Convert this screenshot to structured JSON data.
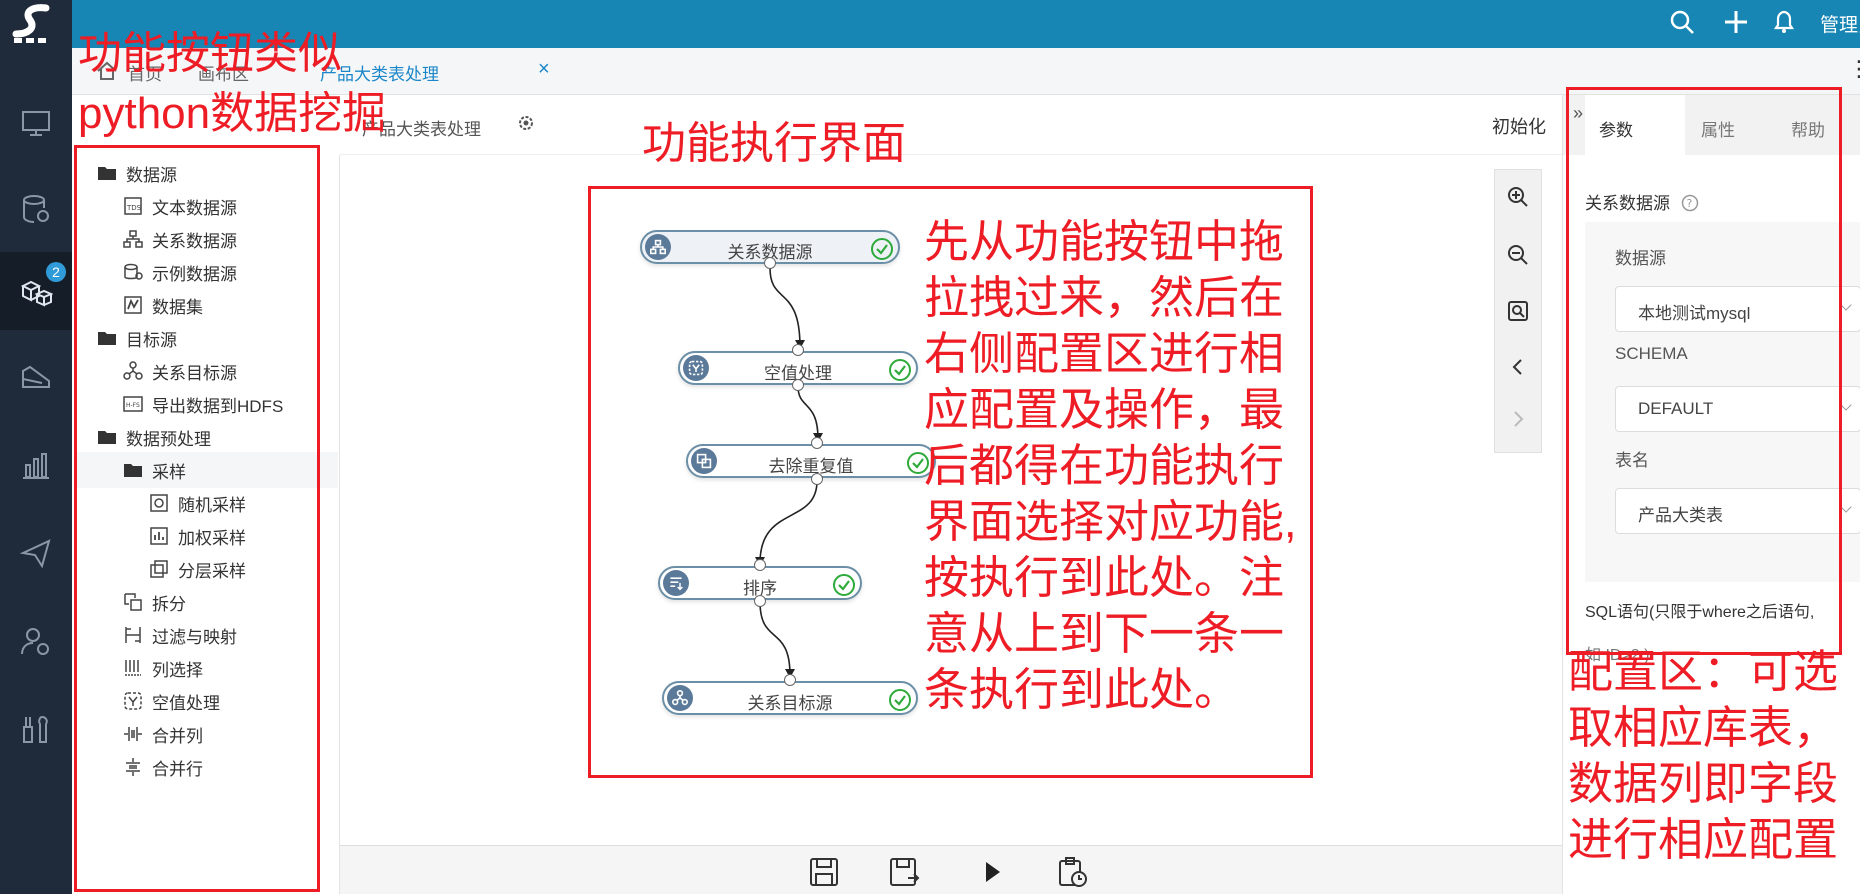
{
  "header": {
    "user_label": "管理员"
  },
  "nav_rail": {
    "badge_count": "2"
  },
  "tabs": [
    {
      "label": "首页"
    },
    {
      "label": "画布区"
    },
    {
      "label": "产品大类表处理"
    }
  ],
  "workspace": {
    "title": "产品大类表处理",
    "init_label": "初始化"
  },
  "tree": {
    "items": [
      {
        "label": "数据源",
        "icon": "folder-icon"
      },
      {
        "label": "文本数据源",
        "icon": "txt-file-icon"
      },
      {
        "label": "关系数据源",
        "icon": "relational-icon"
      },
      {
        "label": "示例数据源",
        "icon": "database-icon"
      },
      {
        "label": "数据集",
        "icon": "dataset-icon"
      },
      {
        "label": "目标源",
        "icon": "folder-icon"
      },
      {
        "label": "关系目标源",
        "icon": "relational-target-icon"
      },
      {
        "label": "导出数据到HDFS",
        "icon": "hdfs-icon"
      },
      {
        "label": "数据预处理",
        "icon": "folder-icon"
      },
      {
        "label": "采样",
        "icon": "folder-icon"
      },
      {
        "label": "随机采样",
        "icon": "random-sample-icon"
      },
      {
        "label": "加权采样",
        "icon": "weighted-sample-icon"
      },
      {
        "label": "分层采样",
        "icon": "layered-sample-icon"
      },
      {
        "label": "拆分",
        "icon": "split-icon"
      },
      {
        "label": "过滤与映射",
        "icon": "filter-icon"
      },
      {
        "label": "列选择",
        "icon": "column-select-icon"
      },
      {
        "label": "空值处理",
        "icon": "null-handle-icon"
      },
      {
        "label": "合并列",
        "icon": "merge-column-icon"
      },
      {
        "label": "合并行",
        "icon": "merge-row-icon"
      }
    ]
  },
  "flow": {
    "nodes": [
      {
        "label": "关系数据源",
        "status": "success"
      },
      {
        "label": "空值处理",
        "status": "success"
      },
      {
        "label": "去除重复值",
        "status": "success"
      },
      {
        "label": "排序",
        "status": "success"
      },
      {
        "label": "关系目标源",
        "status": "success"
      }
    ]
  },
  "config_panel": {
    "tabs": [
      {
        "label": "参数"
      },
      {
        "label": "属性"
      },
      {
        "label": "帮助"
      }
    ],
    "section_title": "关系数据源",
    "datasource_label": "数据源",
    "datasource_value": "本地测试mysql",
    "schema_label": "SCHEMA",
    "schema_value": "DEFAULT",
    "table_label": "表名",
    "table_value": "产品大类表",
    "sql_hint": "SQL语句(只限于where之后语句,",
    "sql_hint2": "如 ID>2  )"
  },
  "annotations": {
    "tree_note_line1": "功能按钮类似",
    "tree_note_line2": "python数据挖掘",
    "canvas_note": "功能执行界面",
    "steps_lines": [
      "先从功能按钮中拖",
      "拉拽过来，然后在",
      "右侧配置区进行相",
      "应配置及操作，最",
      "后都得在功能执行",
      "界面选择对应功能,",
      "按执行到此处。注",
      "意从上到下一条一",
      "条执行到此处。"
    ],
    "config_lines": [
      "配置区：可选",
      "取相应库表，",
      "数据列即字段",
      "进行相应配置"
    ]
  },
  "colors": {
    "topbar": "#1786b4",
    "rail": "#1f2a3a",
    "accent": "#1b87c9",
    "annotation": "#ee1c25",
    "success": "#2eaa3a"
  }
}
